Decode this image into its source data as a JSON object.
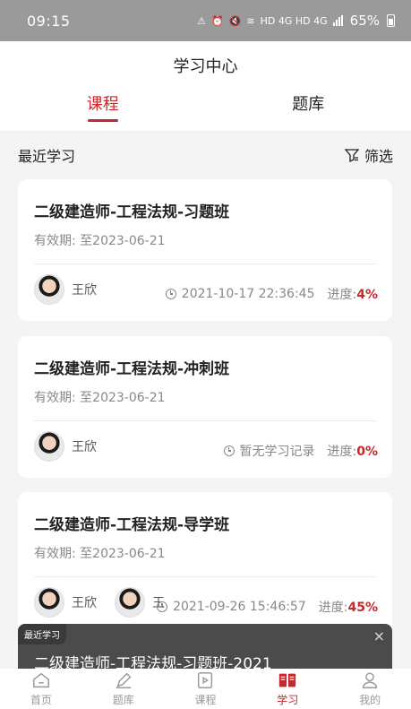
{
  "status_bar": {
    "time": "09:15",
    "icons_text": "HD 4G HD 4G",
    "battery": "65%"
  },
  "header": {
    "title": "学习中心"
  },
  "tabs": [
    {
      "label": "课程",
      "active": true
    },
    {
      "label": "题库",
      "active": false
    }
  ],
  "section": {
    "label": "最近学习",
    "filter_label": "筛选"
  },
  "courses": [
    {
      "name": "二级建造师-工程法规-习题班",
      "validity": "有效期: 至2023-06-21",
      "teachers": [
        "王欣"
      ],
      "last_study": "2021-10-17 22:36:45",
      "progress_label": "进度:",
      "progress_value": "4%"
    },
    {
      "name": "二级建造师-工程法规-冲刺班",
      "validity": "有效期: 至2023-06-21",
      "teachers": [
        "王欣"
      ],
      "last_study": "暂无学习记录",
      "progress_label": "进度:",
      "progress_value": "0%"
    },
    {
      "name": "二级建造师-工程法规-导学班",
      "validity": "有效期: 至2023-06-21",
      "teachers": [
        "王欣",
        "王"
      ],
      "last_study": "2021-09-26 15:46:57",
      "progress_label": "进度:",
      "progress_value": "45%"
    }
  ],
  "recent_popup": {
    "tag": "最近学习",
    "title": "二级建造师-工程法规-习题班-2021",
    "close_icon": "×"
  },
  "bottom_nav": [
    {
      "label": "首页",
      "icon": "home-icon",
      "active": false
    },
    {
      "label": "题库",
      "icon": "pencil-icon",
      "active": false
    },
    {
      "label": "课程",
      "icon": "video-icon",
      "active": false
    },
    {
      "label": "学习",
      "icon": "book-icon",
      "active": true
    },
    {
      "label": "我的",
      "icon": "user-icon",
      "active": false
    }
  ],
  "colors": {
    "accent": "#c8272b",
    "status_bar": "#9a9a9a"
  }
}
